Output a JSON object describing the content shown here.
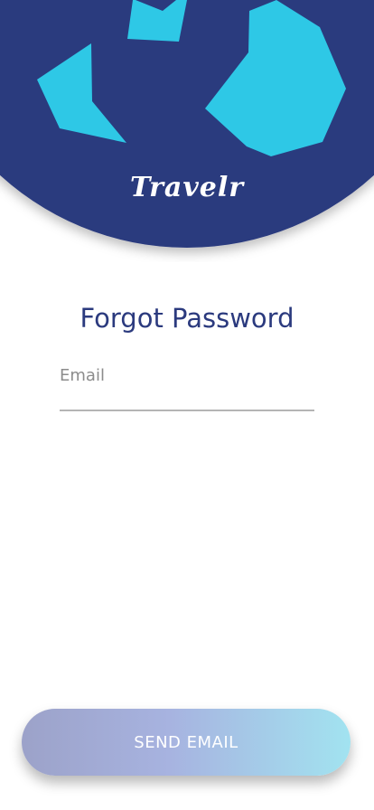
{
  "brand": {
    "name": "Travelr"
  },
  "title": "Forgot Password",
  "form": {
    "email_placeholder": "Email",
    "email_value": ""
  },
  "actions": {
    "send_email_label": "SEND EMAIL"
  },
  "colors": {
    "globe_blue": "#2b3a7e",
    "land_cyan": "#2ec8e6",
    "title_color": "#2b3a7e",
    "button_gradient_start": "#9ca2c9",
    "button_gradient_end": "#a2e3f0"
  }
}
